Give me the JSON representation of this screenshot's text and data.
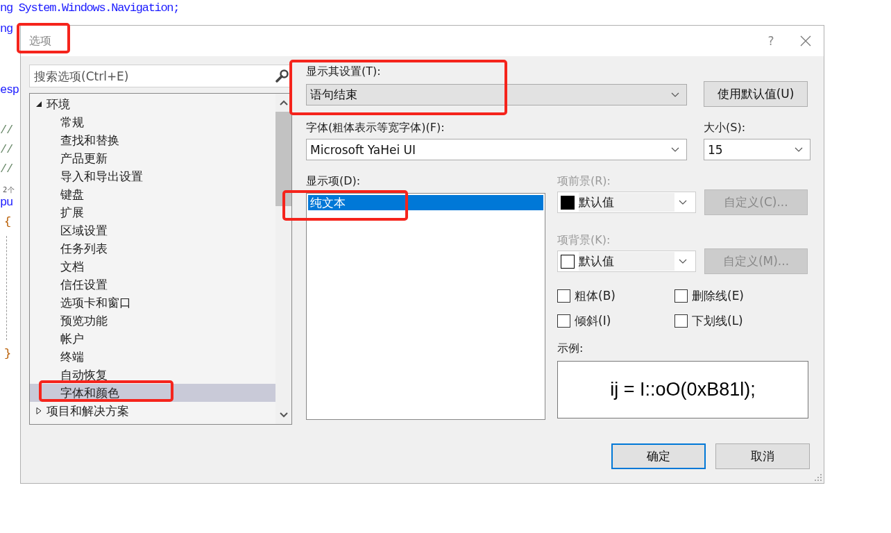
{
  "editor_lines": [
    {
      "text": "ng System.Windows.Navigation;",
      "kind": "code"
    },
    {
      "text": "ng",
      "kind": "code"
    },
    {
      "text": "esp",
      "kind": "code"
    },
    {
      "text": "//",
      "kind": "comment"
    },
    {
      "text": "//",
      "kind": "comment"
    },
    {
      "text": "//",
      "kind": "comment"
    },
    {
      "text": "2 个",
      "kind": "hint"
    },
    {
      "text": "pu",
      "kind": "code"
    },
    {
      "text": "{",
      "kind": "brace"
    },
    {
      "text": "}",
      "kind": "brace"
    }
  ],
  "dialog": {
    "title": "选项",
    "help": "?",
    "search": {
      "placeholder": "搜索选项(Ctrl+E)"
    },
    "tree": [
      {
        "label": "环境",
        "expanded": true,
        "selected": false,
        "children": [
          {
            "label": "常规",
            "selected": false
          },
          {
            "label": "查找和替换",
            "selected": false
          },
          {
            "label": "产品更新",
            "selected": false
          },
          {
            "label": "导入和导出设置",
            "selected": false
          },
          {
            "label": "键盘",
            "selected": false
          },
          {
            "label": "扩展",
            "selected": false
          },
          {
            "label": "区域设置",
            "selected": false
          },
          {
            "label": "任务列表",
            "selected": false
          },
          {
            "label": "文档",
            "selected": false
          },
          {
            "label": "信任设置",
            "selected": false
          },
          {
            "label": "选项卡和窗口",
            "selected": false
          },
          {
            "label": "预览功能",
            "selected": false
          },
          {
            "label": "帐户",
            "selected": false
          },
          {
            "label": "终端",
            "selected": false
          },
          {
            "label": "自动恢复",
            "selected": false
          },
          {
            "label": "字体和颜色",
            "selected": true
          }
        ]
      },
      {
        "label": "项目和解决方案",
        "expanded": false,
        "selected": false
      }
    ],
    "display_settings": {
      "label": "显示其设置(T):",
      "value": "语句结束"
    },
    "use_defaults_button": "使用默认值(U)",
    "font": {
      "label": "字体(粗体表示等宽字体)(F):",
      "value": "Microsoft YaHei UI"
    },
    "size": {
      "label": "大小(S):",
      "value": "15"
    },
    "display_items": {
      "label": "显示项(D):",
      "items": [
        {
          "label": "纯文本",
          "selected": true
        }
      ]
    },
    "foreground": {
      "label": "项前景(R):",
      "disabled": true,
      "color": "#000000",
      "value": "默认值",
      "button": "自定义(C)..."
    },
    "background": {
      "label": "项背景(K):",
      "disabled": true,
      "color": "#ffffff",
      "value": "默认值",
      "button": "自定义(M)..."
    },
    "checkboxes": [
      {
        "label": "粗体(B)",
        "checked": false
      },
      {
        "label": "删除线(E)",
        "checked": false
      },
      {
        "label": "倾斜(I)",
        "checked": false
      },
      {
        "label": "下划线(L)",
        "checked": false
      }
    ],
    "sample": {
      "label": "示例:",
      "text": "ij = I::oO(0xB81l);"
    },
    "buttons": [
      {
        "label": "确定",
        "default": true
      },
      {
        "label": "取消",
        "default": false
      }
    ]
  }
}
